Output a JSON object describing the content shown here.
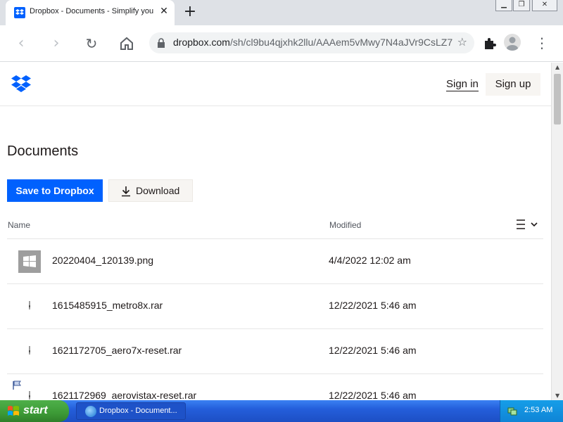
{
  "browser": {
    "tab_title": "Dropbox - Documents - Simplify your",
    "url_host": "dropbox.com",
    "url_path": "/sh/cl9bu4qjxhk2llu/AAAem5vMwy7N4aJVr9CsLZ7",
    "icons": {
      "back": "back-arrow-icon",
      "forward": "forward-arrow-icon",
      "reload": "reload-icon",
      "home": "home-icon",
      "lock": "lock-icon",
      "star": "star-icon",
      "extensions": "puzzle-icon",
      "profile": "profile-icon",
      "menu": "kebab-menu-icon"
    }
  },
  "header": {
    "sign_in": "Sign in",
    "sign_up": "Sign up"
  },
  "main": {
    "title": "Documents",
    "save_button": "Save to Dropbox",
    "download_button": "Download",
    "columns": {
      "name": "Name",
      "modified": "Modified"
    },
    "files": [
      {
        "name": "20220404_120139.png",
        "modified": "4/4/2022 12:02 am",
        "icon": "image-file-icon"
      },
      {
        "name": "1615485915_metro8x.rar",
        "modified": "12/22/2021 5:46 am",
        "icon": "archive-file-icon"
      },
      {
        "name": "1621172705_aero7x-reset.rar",
        "modified": "12/22/2021 5:46 am",
        "icon": "archive-file-icon"
      },
      {
        "name": "1621172969_aerovistax-reset.rar",
        "modified": "12/22/2021 5:46 am",
        "icon": "archive-file-icon"
      }
    ]
  },
  "taskbar": {
    "start": "start",
    "task_title": "Dropbox - Document...",
    "clock": "2:53 AM"
  },
  "colors": {
    "accent": "#0061fe",
    "taskbar": "#245edb",
    "start_green": "#3c9a36"
  }
}
